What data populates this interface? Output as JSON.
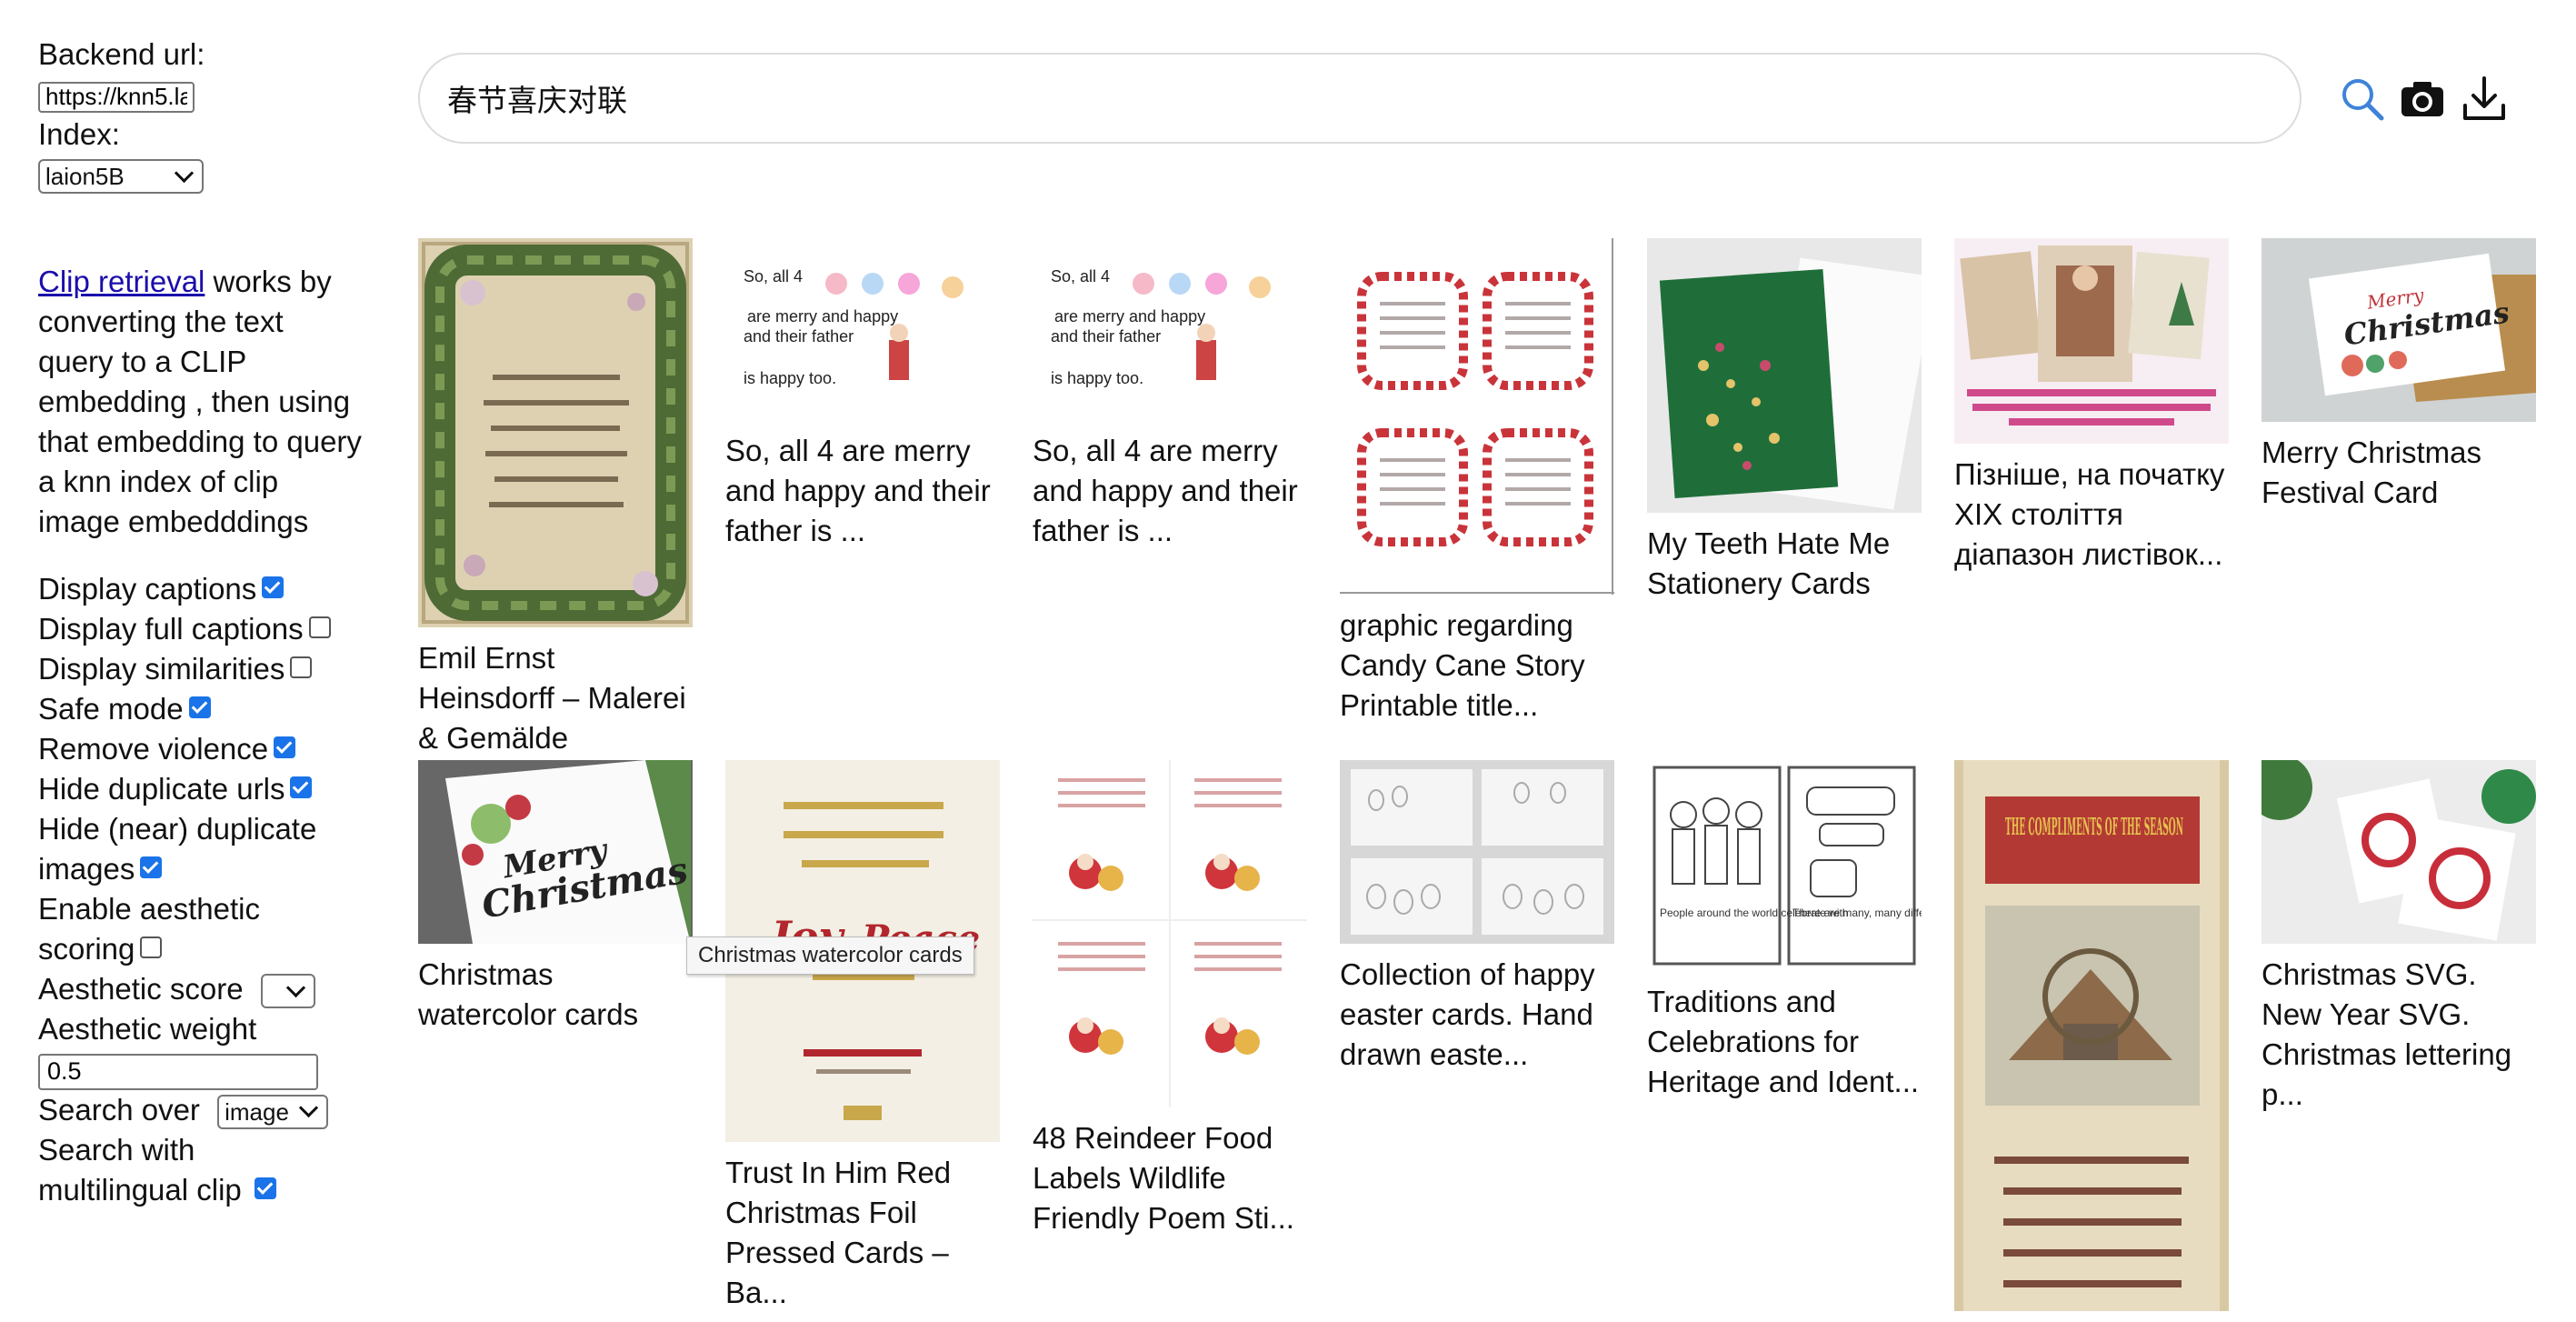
{
  "sidebar": {
    "backend_label": "Backend url:",
    "backend_value": "https://knn5.la",
    "index_label": "Index:",
    "index_value": "laion5B",
    "desc_link": "Clip retrieval",
    "desc_text": " works by converting the text query to a CLIP embedding , then using that embedding to query a knn index of clip image embedddings",
    "options": [
      {
        "label": "Display captions",
        "checked": true
      },
      {
        "label": "Display full captions",
        "checked": false
      },
      {
        "label": "Display similarities",
        "checked": false
      },
      {
        "label": "Safe mode",
        "checked": true
      },
      {
        "label": "Remove violence",
        "checked": true
      },
      {
        "label": "Hide duplicate urls",
        "checked": true
      },
      {
        "label": "Hide (near) duplicate images",
        "checked": true
      },
      {
        "label": "Enable aesthetic scoring",
        "checked": false
      }
    ],
    "aesthetic_score_label": "Aesthetic score",
    "aesthetic_score_value": "",
    "aesthetic_weight_label": "Aesthetic weight",
    "aesthetic_weight_value": "0.5",
    "search_over_label": "Search over",
    "search_over_value": "image",
    "multilingual_label": "Search with multilingual clip",
    "multilingual_checked": true
  },
  "search": {
    "query": "春节喜庆对联",
    "icons": [
      "search-icon",
      "camera-icon",
      "download-icon"
    ]
  },
  "results": [
    {
      "caption": "Emil Ernst Heinsdorff – Malerei & Gemälde",
      "art": "wreath"
    },
    {
      "caption": "So, all 4 are merry and happy and their father is ...",
      "art": "sketch"
    },
    {
      "caption": "So, all 4 are merry and happy and their father is ...",
      "art": "sketch"
    },
    {
      "caption": "graphic regarding Candy Cane Story Printable title...",
      "art": "frames"
    },
    {
      "caption": "My Teeth Hate Me Stationery Cards",
      "art": "green-card"
    },
    {
      "caption": "Пізніше, на початку XIX століття діапазон листівок...",
      "art": "vintage"
    },
    {
      "caption": "Merry Christmas Festival Card",
      "art": "merry-card"
    },
    {
      "caption": "Christmas watercolor cards",
      "art": "watercolor"
    },
    {
      "caption": "Trust In Him Red Christmas Foil Pressed Cards – Ba...",
      "art": "joy-peace"
    },
    {
      "caption": "48 Reindeer Food Labels Wildlife Friendly Poem Sti...",
      "art": "labels"
    },
    {
      "caption": "Collection of happy easter cards. Hand drawn easte...",
      "art": "easter"
    },
    {
      "caption": "Traditions and Celebrations for Heritage and Ident...",
      "art": "coloring"
    },
    {
      "caption": "",
      "art": "compliments"
    },
    {
      "caption": "Christmas SVG. New Year SVG. Christmas lettering p...",
      "art": "svg-cards"
    }
  ],
  "art_text": {
    "sketch_line1": "So, all 4",
    "sketch_line2": "are merry and happy",
    "sketch_line3": "and their  father",
    "sketch_line4": "is happy too.",
    "merry": "Merry",
    "christmas": "Christmas",
    "joy": "Joy",
    "peace": "Peace",
    "compliments_title": "THE COMPLIMENTS OF THE SEASON",
    "coloring_1": "People around the world celebrate with",
    "coloring_2": "There are many, many different holidays and"
  },
  "tooltip": "Christmas watercolor cards"
}
